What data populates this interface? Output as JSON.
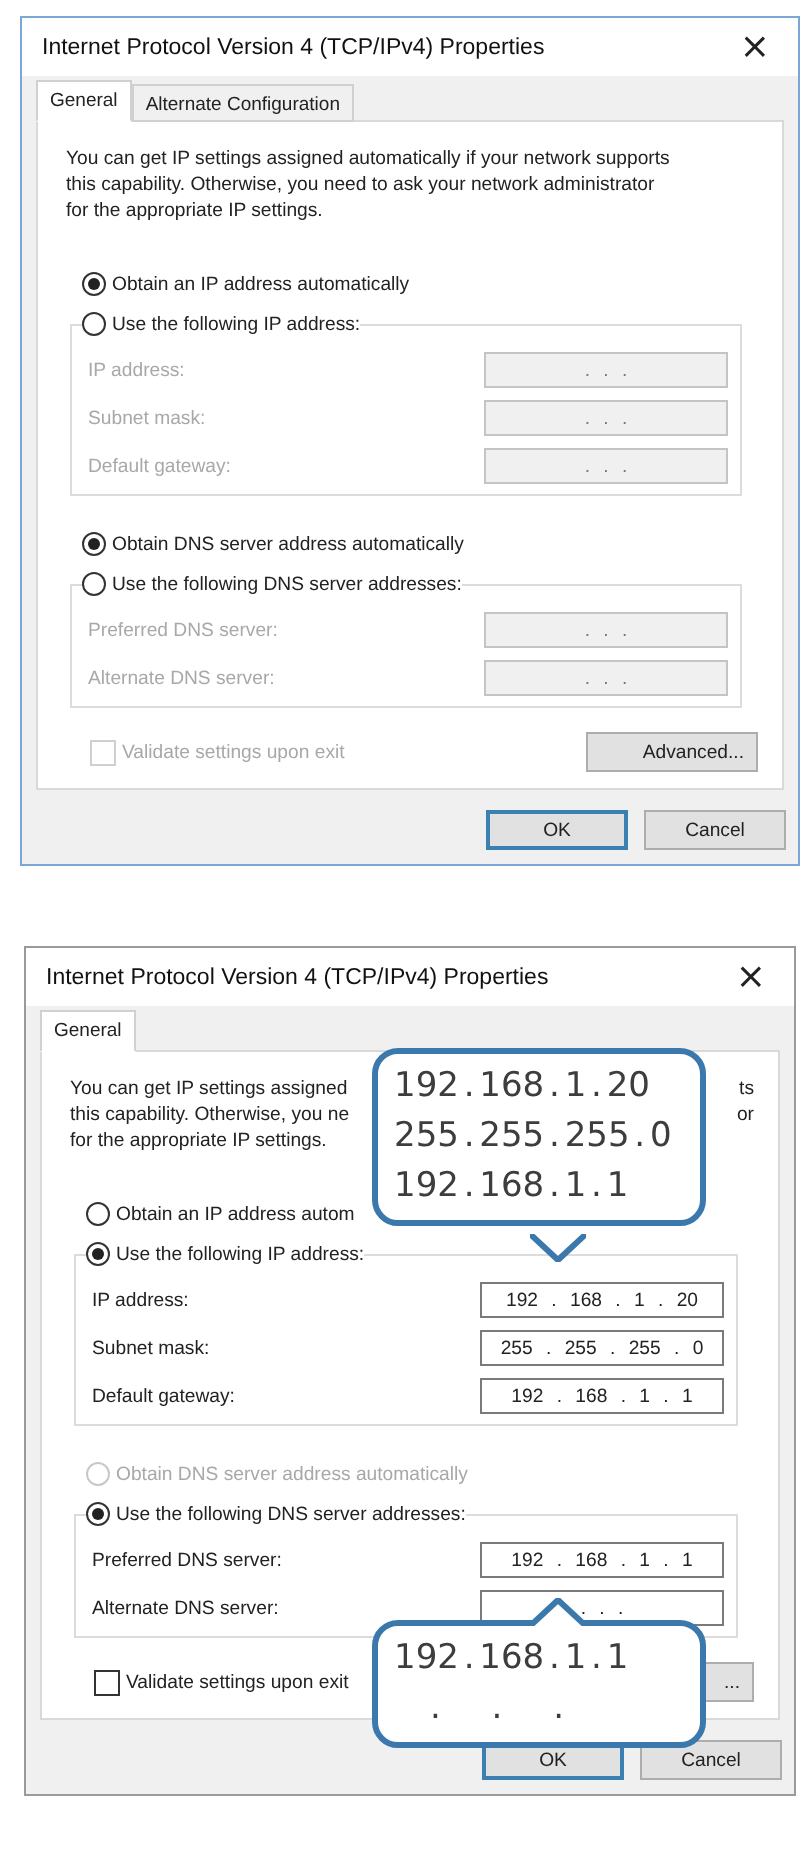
{
  "dialogs": [
    {
      "title": "Internet Protocol Version 4 (TCP/IPv4) Properties",
      "close": "×",
      "tabs": [
        {
          "label": "General",
          "selected": true
        },
        {
          "label": "Alternate Configuration",
          "selected": false
        }
      ],
      "description": [
        {
          "text": "You can get IP settings assigned automatically if your network supports"
        },
        {
          "text": "this capability. Otherwise, you need to ask your network administrator"
        },
        {
          "text": "for the appropriate IP settings."
        }
      ],
      "ip_options": [
        {
          "label": "Obtain an IP address automatically",
          "selected": true,
          "disabled": false
        },
        {
          "label": "Use the following IP address:",
          "selected": false,
          "disabled": false
        }
      ],
      "ip_fields": [
        {
          "label": "IP address:",
          "value": ". . .",
          "disabled": true
        },
        {
          "label": "Subnet mask:",
          "value": ". . .",
          "disabled": true
        },
        {
          "label": "Default gateway:",
          "value": ". . .",
          "disabled": true
        }
      ],
      "dns_options": [
        {
          "label": "Obtain DNS server address automatically",
          "selected": true,
          "disabled": false
        },
        {
          "label": "Use the following DNS server addresses:",
          "selected": false,
          "disabled": false
        }
      ],
      "dns_fields": [
        {
          "label": "Preferred DNS server:",
          "value": ". . .",
          "disabled": true
        },
        {
          "label": "Alternate DNS server:",
          "value": ". . .",
          "disabled": true
        }
      ],
      "validate": {
        "label": "Validate settings upon exit",
        "checked": false,
        "disabled": true
      },
      "advanced_button": "Advanced...",
      "buttons": [
        {
          "label": "OK",
          "default": true
        },
        {
          "label": "Cancel",
          "default": false
        }
      ]
    },
    {
      "title": "Internet Protocol Version 4 (TCP/IPv4) Properties",
      "close": "×",
      "tabs": [
        {
          "label": "General",
          "selected": true
        }
      ],
      "description": [
        {
          "text": "You can get IP settings assigned",
          "tail": "ts"
        },
        {
          "text": "this capability. Otherwise, you ne",
          "tail": "or"
        },
        {
          "text": "for the appropriate IP settings."
        }
      ],
      "ip_options": [
        {
          "label": "Obtain an IP address autom",
          "selected": false,
          "disabled": false
        },
        {
          "label": "Use the following IP address:",
          "selected": true,
          "disabled": false
        }
      ],
      "ip_fields": [
        {
          "label": "IP address:",
          "value": "192 . 168 . 1 . 20",
          "disabled": false
        },
        {
          "label": "Subnet mask:",
          "value": "255 . 255 . 255 . 0",
          "disabled": false
        },
        {
          "label": "Default gateway:",
          "value": "192 . 168 . 1 . 1",
          "disabled": false
        }
      ],
      "dns_options": [
        {
          "label": "Obtain DNS server address automatically",
          "selected": false,
          "disabled": true
        },
        {
          "label": "Use the following DNS server addresses:",
          "selected": true,
          "disabled": false
        }
      ],
      "dns_fields": [
        {
          "label": "Preferred DNS server:",
          "value": "192 . 168 . 1 . 1",
          "disabled": false
        },
        {
          "label": "Alternate DNS server:",
          "value": ". . .",
          "disabled": false
        }
      ],
      "validate": {
        "label": "Validate settings upon exit",
        "checked": false,
        "disabled": false
      },
      "advanced_button": "...",
      "buttons": [
        {
          "label": "OK",
          "default": true
        },
        {
          "label": "Cancel",
          "default": false
        }
      ],
      "callouts": [
        {
          "lines": [
            "192 . 168 . 1 . 20",
            "255 . 255 . 255 . 0",
            "192 . 168 . 1 . 1"
          ]
        },
        {
          "lines": [
            "192 . 168 . 1 . 1",
            ". . ."
          ]
        }
      ]
    }
  ]
}
